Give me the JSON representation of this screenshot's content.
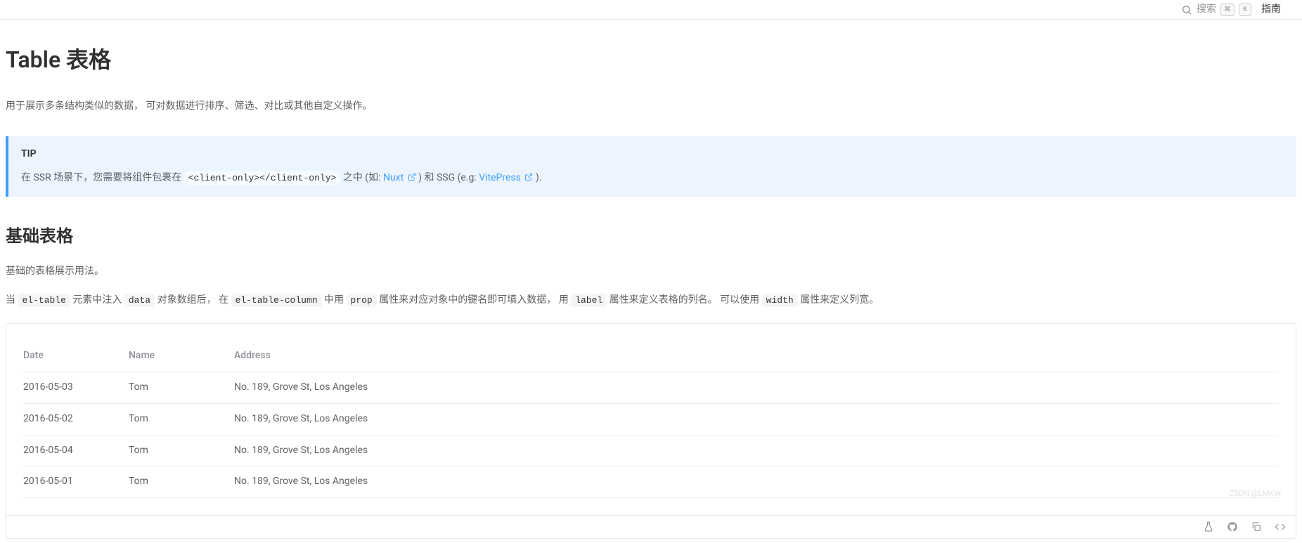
{
  "topbar": {
    "search_placeholder": "搜索",
    "kbd1": "⌘",
    "kbd2": "K",
    "nav_guide": "指南"
  },
  "page": {
    "title": "Table 表格",
    "intro": "用于展示多条结构类似的数据， 可对数据进行排序、筛选、对比或其他自定义操作。"
  },
  "tip": {
    "label": "TIP",
    "prefix": "在 SSR 场景下，您需要将组件包裹在 ",
    "code": "<client-only></client-only>",
    "mid1": " 之中 (如: ",
    "link1": "Nuxt",
    "mid2": ") 和 SSG (e.g: ",
    "link2": "VitePress",
    "suffix": ")."
  },
  "section": {
    "title": "基础表格",
    "desc": "基础的表格展示用法。",
    "detail": {
      "t1": "当 ",
      "c1": "el-table",
      "t2": " 元素中注入 ",
      "c2": "data",
      "t3": " 对象数组后， 在 ",
      "c3": "el-table-column",
      "t4": " 中用 ",
      "c4": "prop",
      "t5": " 属性来对应对象中的键名即可填入数据， 用 ",
      "c5": "label",
      "t6": " 属性来定义表格的列名。 可以使用 ",
      "c6": "width",
      "t7": " 属性来定义列宽。"
    }
  },
  "table": {
    "headers": [
      "Date",
      "Name",
      "Address"
    ],
    "rows": [
      {
        "date": "2016-05-03",
        "name": "Tom",
        "address": "No. 189, Grove St, Los Angeles"
      },
      {
        "date": "2016-05-02",
        "name": "Tom",
        "address": "No. 189, Grove St, Los Angeles"
      },
      {
        "date": "2016-05-04",
        "name": "Tom",
        "address": "No. 189, Grove St, Los Angeles"
      },
      {
        "date": "2016-05-01",
        "name": "Tom",
        "address": "No. 189, Grove St, Los Angeles"
      }
    ]
  },
  "watermark": "CSDN @LMKW"
}
